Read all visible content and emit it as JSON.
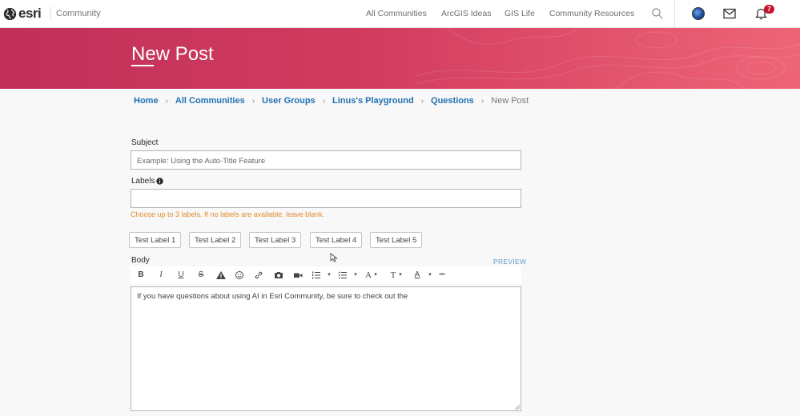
{
  "header": {
    "logo_text": "esri",
    "community_label": "Community",
    "nav": [
      "All Communities",
      "ArcGIS Ideas",
      "GIS Life",
      "Community Resources"
    ],
    "notification_count": "7"
  },
  "banner": {
    "title": "New Post"
  },
  "breadcrumb": {
    "links": [
      "Home",
      "All Communities",
      "User Groups",
      "Linus's Playground",
      "Questions"
    ],
    "current": "New Post"
  },
  "form": {
    "subject_label": "Subject",
    "subject_placeholder": "Example: Using the Auto-Title Feature",
    "labels_label": "Labels",
    "labels_value": "",
    "labels_hint": "Choose up to 3 labels. If no labels are available, leave blank.",
    "chips": [
      "Test Label 1",
      "Test Label 2",
      "Test Label 3",
      "Test Label 4",
      "Test Label 5"
    ],
    "body_label": "Body",
    "preview_label": "PREVIEW",
    "body_text": "If you have questions about using AI in Esri Community, be sure to check out the"
  },
  "toolbar": {
    "bold": "B",
    "italic": "I",
    "underline": "U",
    "strike": "S",
    "font": "A",
    "size": "T",
    "color": "A",
    "more": "•••"
  }
}
